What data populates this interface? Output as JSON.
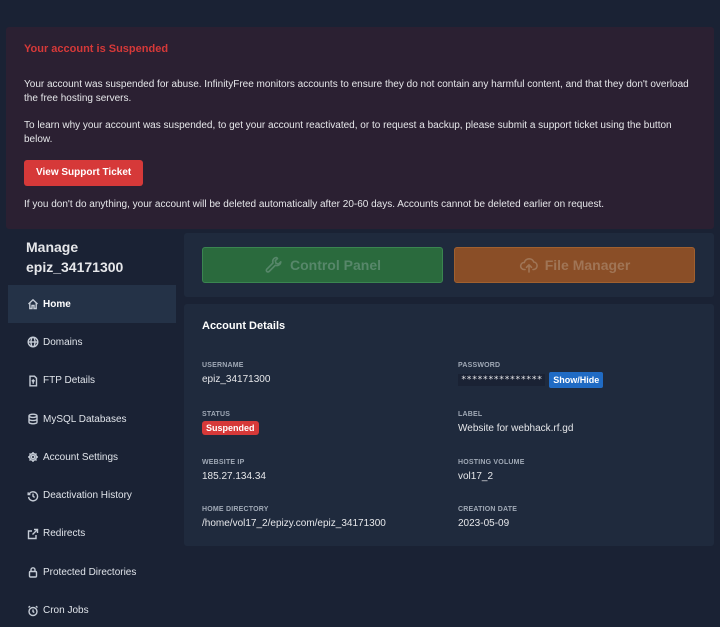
{
  "alert": {
    "title": "Your account is Suspended",
    "paragraph1": "Your account was suspended for abuse. InfinityFree monitors accounts to ensure they do not contain any harmful content, and that they don't overload the free hosting servers.",
    "paragraph2": "To learn why your account was suspended, to get your account reactivated, or to request a backup, please submit a support ticket using the button below.",
    "button_label": "View Support Ticket",
    "paragraph3": "If you don't do anything, your account will be deleted automatically after 20-60 days. Accounts cannot be deleted earlier on request."
  },
  "sidebar": {
    "title_line1": "Manage",
    "title_line2": "epiz_34171300",
    "items": [
      {
        "label": "Home",
        "icon": "home-icon",
        "active": true
      },
      {
        "label": "Domains",
        "icon": "globe-icon"
      },
      {
        "label": "FTP Details",
        "icon": "file-upload-icon"
      },
      {
        "label": "MySQL Databases",
        "icon": "database-icon"
      },
      {
        "label": "Account Settings",
        "icon": "gear-icon"
      },
      {
        "label": "Deactivation History",
        "icon": "history-icon"
      },
      {
        "label": "Redirects",
        "icon": "external-link-icon"
      },
      {
        "label": "Protected Directories",
        "icon": "lock-icon"
      },
      {
        "label": "Cron Jobs",
        "icon": "alarm-clock-icon"
      }
    ]
  },
  "actions": {
    "control_panel": "Control Panel",
    "file_manager": "File Manager"
  },
  "details": {
    "title": "Account Details",
    "username_label": "USERNAME",
    "username": "epiz_34171300",
    "password_label": "PASSWORD",
    "password_mask": "***************",
    "showhide_label": "Show/Hide",
    "status_label": "STATUS",
    "status": "Suspended",
    "label_label": "LABEL",
    "label": "Website for webhack.rf.gd",
    "ip_label": "WEBSITE IP",
    "ip": "185.27.134.34",
    "volume_label": "HOSTING VOLUME",
    "volume": "vol17_2",
    "homedir_label": "HOME DIRECTORY",
    "homedir": "/home/vol17_2/epizy.com/epiz_34171300",
    "created_label": "CREATION DATE",
    "created": "2023-05-09"
  },
  "colors": {
    "background": "#1a2234",
    "alert_bg": "#2b2032",
    "danger": "#d63939",
    "success": "#2a6a3d",
    "warning": "#8a4e27",
    "primary": "#206bc4"
  }
}
